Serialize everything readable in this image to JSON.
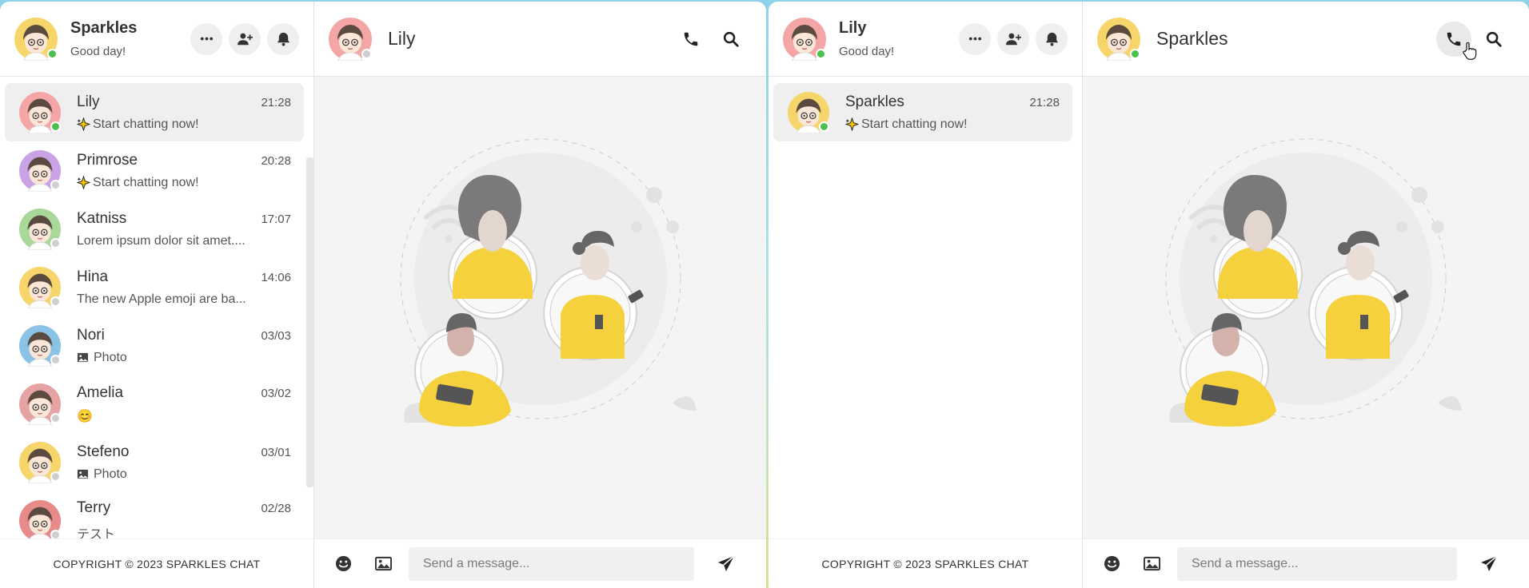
{
  "left": {
    "me": {
      "name": "Sparkles",
      "status": "Good day!",
      "avatar_color": "#f6d56b",
      "online_color": "#4cc04c"
    },
    "chat": {
      "name": "Lily",
      "avatar_color": "#f4a6a6"
    },
    "contacts": [
      {
        "name": "Lily",
        "time": "21:28",
        "msg": "Start chatting now!",
        "msg_icon": "sparkle-icon",
        "color": "#f4a6a6",
        "online": true,
        "active": true
      },
      {
        "name": "Primrose",
        "time": "20:28",
        "msg": "Start chatting now!",
        "msg_icon": "sparkle-icon",
        "color": "#c9a3e6",
        "online": false,
        "active": false
      },
      {
        "name": "Katniss",
        "time": "17:07",
        "msg": "Lorem ipsum dolor sit amet....",
        "msg_icon": "",
        "color": "#a8d89a",
        "online": false,
        "active": false
      },
      {
        "name": "Hina",
        "time": "14:06",
        "msg": "The new Apple emoji are ba...",
        "msg_icon": "",
        "color": "#f6d56b",
        "online": false,
        "active": false
      },
      {
        "name": "Nori",
        "time": "03/03",
        "msg": "Photo",
        "msg_icon": "image-icon",
        "color": "#8bc3e6",
        "online": false,
        "active": false
      },
      {
        "name": "Amelia",
        "time": "03/02",
        "msg": "😊",
        "msg_icon": "",
        "color": "#e6a3a3",
        "online": false,
        "active": false
      },
      {
        "name": "Stefeno",
        "time": "03/01",
        "msg": "Photo",
        "msg_icon": "image-icon",
        "color": "#f6d56b",
        "online": false,
        "active": false
      },
      {
        "name": "Terry",
        "time": "02/28",
        "msg": "テスト",
        "msg_icon": "",
        "color": "#e68a8a",
        "online": false,
        "active": false
      }
    ],
    "copyright": "COPYRIGHT © 2023 SPARKLES CHAT",
    "placeholder": "Send a message..."
  },
  "right": {
    "me": {
      "name": "Lily",
      "status": "Good day!",
      "avatar_color": "#f4a6a6",
      "online_color": "#4cc04c"
    },
    "chat": {
      "name": "Sparkles",
      "avatar_color": "#f6d56b"
    },
    "contacts": [
      {
        "name": "Sparkles",
        "time": "21:28",
        "msg": "Start chatting now!",
        "msg_icon": "sparkle-icon",
        "color": "#f6d56b",
        "online": true,
        "active": true
      }
    ],
    "copyright": "COPYRIGHT © 2023 SPARKLES CHAT",
    "placeholder": "Send a message..."
  },
  "icons": {
    "more": "more-icon",
    "add_user": "add-user-icon",
    "bell": "bell-icon",
    "phone": "phone-icon",
    "search": "search-icon",
    "emoji": "emoji-icon",
    "image": "image-icon",
    "send": "send-icon"
  }
}
